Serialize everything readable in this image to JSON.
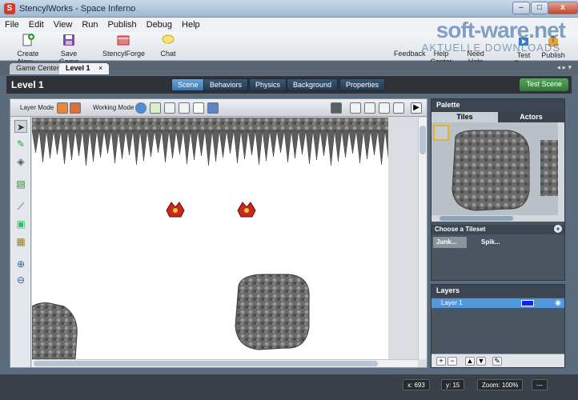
{
  "window": {
    "title": "StencylWorks - Space Inferno",
    "app_icon": "S"
  },
  "menu": [
    "File",
    "Edit",
    "View",
    "Run",
    "Publish",
    "Debug",
    "Help"
  ],
  "toolbar": {
    "create": "Create New...",
    "save": "Save Game",
    "forge": "StencylForge",
    "chat": "Chat",
    "feedback": "Feedback",
    "help_center": "Help Center",
    "need_help": "Need Help",
    "test_game": "Test Game",
    "publish": "Publish"
  },
  "watermark": {
    "brand": "soft-ware.net",
    "tagline": "AKTUELLE DOWNLOADS"
  },
  "tabs": [
    {
      "label": "Game Center",
      "active": false
    },
    {
      "label": "Level 1",
      "active": true,
      "close": "×"
    }
  ],
  "scene": {
    "title": "Level 1",
    "modes": [
      "Scene",
      "Behaviors",
      "Physics",
      "Background",
      "Properties"
    ],
    "selected_mode": "Scene",
    "test_button": "Test Scene"
  },
  "editor": {
    "layer_mode_label": "Layer Mode",
    "working_mode_label": "Working Mode"
  },
  "palette": {
    "title": "Palette",
    "tabs": [
      "Tiles",
      "Actors"
    ],
    "selected_tab": "Tiles",
    "choose_tileset_label": "Choose a Tileset",
    "tilesets": [
      "Junk...",
      "Spik..."
    ]
  },
  "layers": {
    "title": "Layers",
    "items": [
      {
        "name": "Layer 1",
        "color": "#1220ff"
      }
    ]
  },
  "status": {
    "x": "x:  693",
    "y": "y:   15",
    "zoom": "Zoom:  100%",
    "extra": "---"
  },
  "colors": {
    "accent_blue": "#3a76b3",
    "test_green": "#2f7a36",
    "panel_dark": "#4a5561"
  }
}
